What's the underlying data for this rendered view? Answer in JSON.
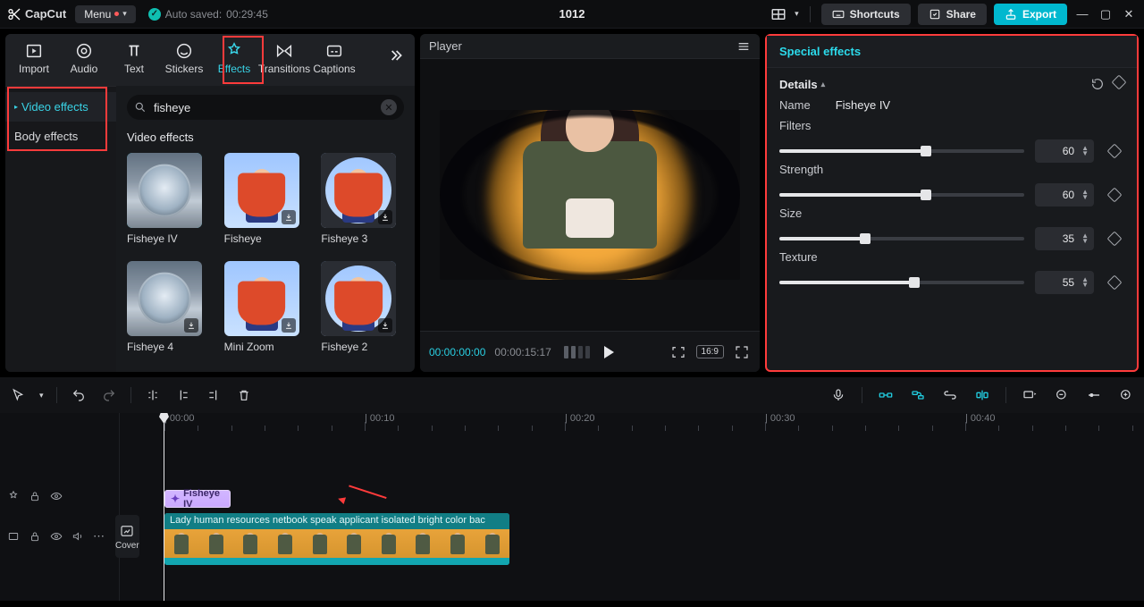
{
  "titlebar": {
    "brand": "CapCut",
    "menu": "Menu",
    "autosave_label": "Auto saved:",
    "autosave_time": "00:29:45",
    "project_title": "1012",
    "shortcuts": "Shortcuts",
    "share": "Share",
    "export": "Export"
  },
  "leftnav": {
    "tabs": [
      "Import",
      "Audio",
      "Text",
      "Stickers",
      "Effects",
      "Transitions",
      "Captions"
    ],
    "active_index": 4
  },
  "left_sidebar": {
    "items": [
      "Video effects",
      "Body effects"
    ],
    "active_index": 0
  },
  "search": {
    "value": "fisheye"
  },
  "effects": {
    "section_label": "Video effects",
    "items": [
      {
        "label": "Fisheye IV",
        "kind": "fisheye",
        "selected": true,
        "downloadable": false
      },
      {
        "label": "Fisheye",
        "kind": "person",
        "selected": false,
        "downloadable": true
      },
      {
        "label": "Fisheye 3",
        "kind": "person-round",
        "selected": false,
        "downloadable": true
      },
      {
        "label": "Fisheye 4",
        "kind": "fisheye",
        "selected": false,
        "downloadable": true
      },
      {
        "label": "Mini Zoom",
        "kind": "person",
        "selected": false,
        "downloadable": true
      },
      {
        "label": "Fisheye 2",
        "kind": "person-round",
        "selected": false,
        "downloadable": true
      }
    ]
  },
  "player": {
    "label": "Player",
    "time_current": "00:00:00:00",
    "time_duration": "00:00:15:17",
    "aspect": "16:9"
  },
  "inspector": {
    "title": "Special effects",
    "details": "Details",
    "name_label": "Name",
    "name_value": "Fisheye IV",
    "params": [
      {
        "label": "Filters",
        "value": 60,
        "max": 100
      },
      {
        "label": "Strength",
        "value": 60,
        "max": 100
      },
      {
        "label": "Size",
        "value": 35,
        "max": 100
      },
      {
        "label": "Texture",
        "value": 55,
        "max": 100
      }
    ]
  },
  "timeline": {
    "ruler": [
      "00:00",
      "00:10",
      "00:20",
      "00:30",
      "00:40"
    ],
    "effect_clip": "Fisheye IV",
    "video_clip_title": "Lady human resources netbook speak applicant isolated bright color bac",
    "cover": "Cover"
  }
}
